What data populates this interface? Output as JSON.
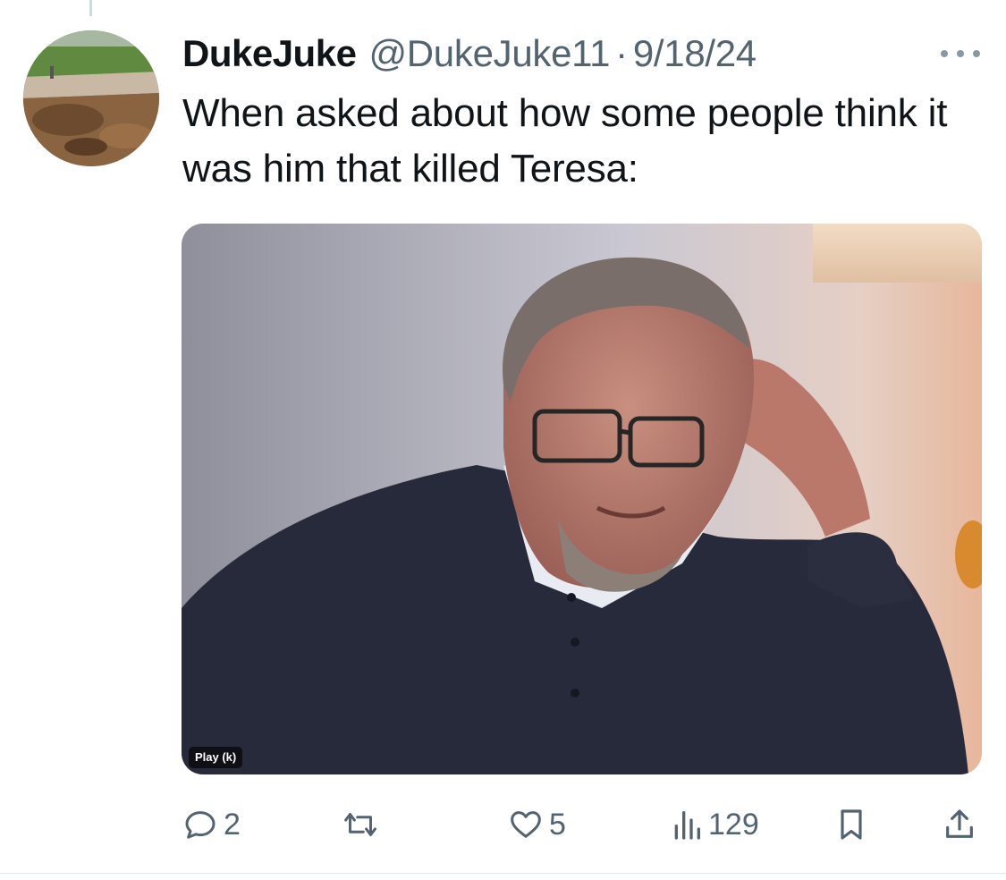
{
  "tweet": {
    "display_name": "DukeJuke",
    "handle": "@DukeJuke11",
    "separator": "·",
    "date": "9/18/24",
    "text": "When asked about how some people think it was him that killed Teresa:",
    "avatar_icon": "landscape-avatar"
  },
  "media": {
    "type": "video",
    "play_label": "Play (k)"
  },
  "actions": {
    "replies": "2",
    "reposts": "",
    "likes": "5",
    "views": "129"
  },
  "icons": {
    "more": "more-horizontal-icon",
    "reply": "reply-icon",
    "repost": "repost-icon",
    "like": "heart-icon",
    "views": "views-icon",
    "bookmark": "bookmark-icon",
    "share": "share-icon"
  },
  "colors": {
    "text_primary": "#0f1419",
    "text_secondary": "#536471",
    "background": "#ffffff"
  }
}
